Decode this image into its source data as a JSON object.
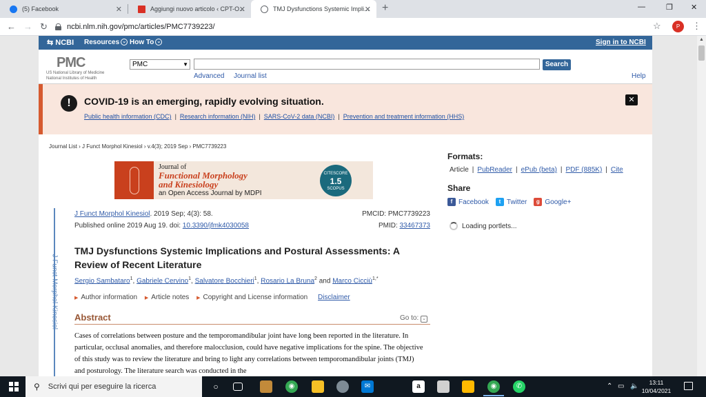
{
  "browser": {
    "tabs": [
      {
        "title": "(5) Facebook",
        "color": "#1877f2"
      },
      {
        "title": "Aggiungi nuovo articolo ‹ CPT-O...",
        "color": "#d93025"
      },
      {
        "title": "TMJ Dysfunctions Systemic Impli...",
        "color": "#5f6368"
      }
    ],
    "url": "ncbi.nlm.nih.gov/pmc/articles/PMC7739223/",
    "profile_initial": "P"
  },
  "ncbi": {
    "logo": "NCBI",
    "resources": "Resources",
    "howto": "How To",
    "signin": "Sign in to NCBI"
  },
  "search": {
    "pmc_logo": "PMC",
    "nlm_line1": "US National Library of Medicine",
    "nlm_line2": "National Institutes of Health",
    "database": "PMC",
    "query": "",
    "button": "Search",
    "advanced": "Advanced",
    "journal_list": "Journal list",
    "help": "Help"
  },
  "covid": {
    "title": "COVID-19 is an emerging, rapidly evolving situation.",
    "links": [
      "Public health information (CDC)",
      "Research information (NIH)",
      "SARS-CoV-2 data (NCBI)",
      "Prevention and treatment information (HHS)"
    ],
    "sep": "|"
  },
  "breadcrumb": "Journal List › J Funct Morphol Kinesiol › v.4(3); 2019 Sep › PMC7739223",
  "banner": {
    "journal_of": "Journal of",
    "line1": "Functional Morphology",
    "line2": "and Kinesiology",
    "line3": "an Open Access Journal by MDPI",
    "badge_top": "CITESCORE",
    "badge_value": "1.5",
    "badge_bottom": "SCOPUS"
  },
  "article": {
    "side_label": "J Funct Morphol Kinesiol",
    "journal": "J Funct Morphol Kinesiol",
    "issue": ". 2019 Sep; 4(3): 58.",
    "published": "Published online 2019 Aug 19. doi: ",
    "doi": "10.3390/jfmk4030058",
    "pmcid_label": "PMCID: PMC7739223",
    "pmid_label": "PMID: ",
    "pmid": "33467373",
    "title": "TMJ Dysfunctions Systemic Implications and Postural Assessments: A Review of Recent Literature",
    "authors": [
      {
        "name": "Sergio Sambataro",
        "sup": "1"
      },
      {
        "name": "Gabriele Cervino",
        "sup": "1"
      },
      {
        "name": "Salvatore Bocchieri",
        "sup": "1"
      },
      {
        "name": "Rosario La Bruna",
        "sup": "2"
      },
      {
        "name": "Marco Cicciù",
        "sup": "1,*"
      }
    ],
    "author_joiner": "and",
    "meta": [
      "Author information",
      "Article notes",
      "Copyright and License information"
    ],
    "disclaimer": "Disclaimer",
    "abstract_heading": "Abstract",
    "goto": "Go to:",
    "abstract_text": "Cases of correlations between posture and the temporomandibular joint have long been reported in the literature. In particular, occlusal anomalies, and therefore malocclusion, could have negative implications for the spine. The objective of this study was to review the literature and bring to light any correlations between temporomandibular joints (TMJ) and posturology. The literature search was conducted in the"
  },
  "sidebar": {
    "formats_heading": "Formats:",
    "formats": [
      "Article",
      "PubReader",
      "ePub (beta)",
      "PDF (885K)",
      "Cite"
    ],
    "share_heading": "Share",
    "share": [
      {
        "label": "Facebook",
        "color": "#3b5998",
        "glyph": "f"
      },
      {
        "label": "Twitter",
        "color": "#1da1f2",
        "glyph": "t"
      },
      {
        "label": "Google+",
        "color": "#dd4b39",
        "glyph": "g"
      }
    ],
    "loading": "Loading portlets..."
  },
  "taskbar": {
    "search_placeholder": "Scrivi qui per eseguire la ricerca",
    "time": "13:11",
    "date": "10/04/2021"
  }
}
